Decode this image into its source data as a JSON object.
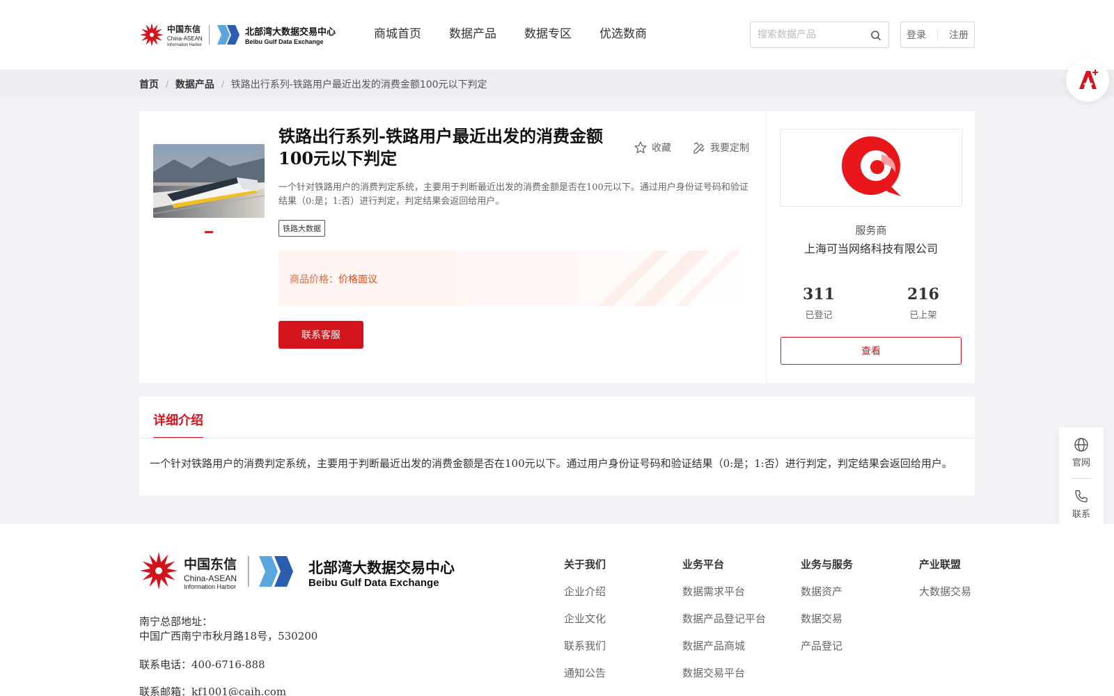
{
  "header": {
    "logo_text_cn": "中国东信",
    "logo_text_en1": "China-ASEAN",
    "logo_text_en2": "Information Harbor",
    "brand_cn": "北部湾大数据交易中心",
    "brand_en": "Beibu Gulf Data Exchange",
    "nav": [
      "商城首页",
      "数据产品",
      "数据专区",
      "优选数商"
    ],
    "search_placeholder": "搜索数据产品",
    "login": "登录",
    "register": "注册"
  },
  "breadcrumb": {
    "home": "首页",
    "section": "数据产品",
    "current": "铁路出行系列-铁路用户最近出发的消费金额100元以下判定",
    "separator": "/"
  },
  "product": {
    "title": "铁路出行系列-铁路用户最近出发的消费金额100元以下判定",
    "favorite": "收藏",
    "customize": "我要定制",
    "description": "一个针对铁路用户的消费判定系统，主要用于判断最近出发的消费金额是否在100元以下。通过用户身份证号码和验证结果（0:是；1:否）进行判定，判定结果会返回给用户。",
    "tag": "铁路大数据",
    "price_label": "商品价格：",
    "price_value": "价格面议",
    "contact_button": "联系客服"
  },
  "provider": {
    "role": "服务商",
    "name": "上海可当网络科技有限公司",
    "registered_count": "311",
    "registered_label": "已登记",
    "listed_count": "216",
    "listed_label": "已上架",
    "view_button": "查看"
  },
  "detail": {
    "tab": "详细介绍",
    "text": "一个针对铁路用户的消费判定系统，主要用于判断最近出发的消费金额是否在100元以下。通过用户身份证号码和验证结果（0:是；1:否）进行判定，判定结果会返回给用户。"
  },
  "float_side": {
    "site": "官网",
    "contact": "联系"
  },
  "footer": {
    "address_label": "南宁总部地址：",
    "address": "中国广西南宁市秋月路18号，530200",
    "phone": "联系电话：400-6716-888",
    "email": "联系邮箱：kf1001@caih.com",
    "columns": [
      {
        "title": "关于我们",
        "items": [
          "企业介绍",
          "企业文化",
          "联系我们",
          "通知公告"
        ]
      },
      {
        "title": "业务平台",
        "items": [
          "数据需求平台",
          "数据产品登记平台",
          "数据产品商城",
          "数据交易平台"
        ]
      },
      {
        "title": "业务与服务",
        "items": [
          "数据资产",
          "数据交易",
          "产品登记"
        ]
      },
      {
        "title": "产业联盟",
        "items": [
          "大数据交易"
        ]
      }
    ]
  },
  "colors": {
    "brand_red": "#d2141d",
    "price_orange": "#e64a14",
    "accent_blue": "#2a5fb0"
  }
}
